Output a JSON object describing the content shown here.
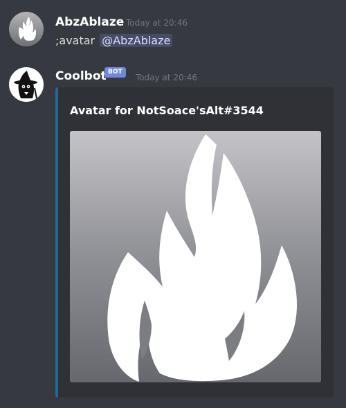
{
  "messages": [
    {
      "author": "AbzAblaze",
      "avatar_icon": "flame-icon",
      "timestamp": "Today at 20:46",
      "content_prefix": ";avatar",
      "mention": "@AbzAblaze"
    },
    {
      "author": "Coolbot",
      "avatar_icon": "witch-hat-character-icon",
      "bot_badge": "BOT",
      "timestamp": "Today at 20:46",
      "embed": {
        "title": "Avatar for NotSoace'sAlt#3544",
        "image_icon": "flame-icon",
        "accent_color": "#1f6a98"
      }
    }
  ],
  "colors": {
    "background": "#36393f",
    "embed_background": "#2f3136",
    "mention_text": "#dee0fc",
    "bot_badge": "#7289da"
  }
}
